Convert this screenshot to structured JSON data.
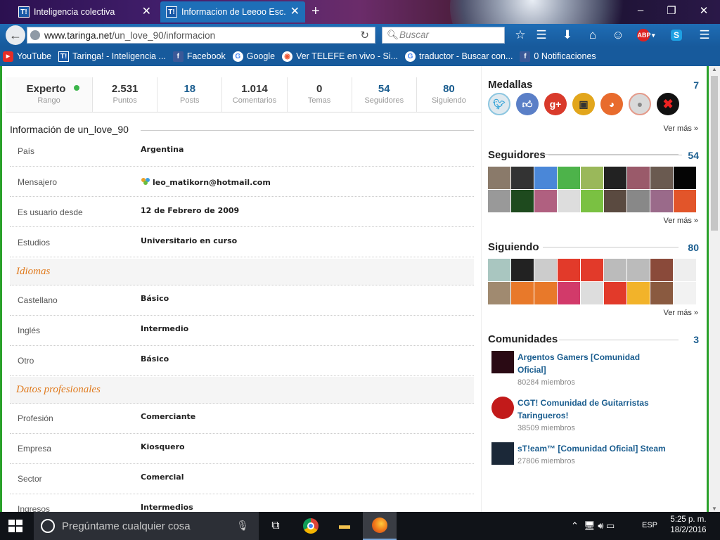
{
  "browser": {
    "tabs": [
      {
        "label": "Inteligencia colectiva",
        "favicon": "T!"
      },
      {
        "label": "Informacion de Leeoo Esc...",
        "favicon": "T!"
      }
    ],
    "url_domain": "www.taringa.net",
    "url_path": "/un_love_90/informacion",
    "search_placeholder": "Buscar",
    "abp_label": "ABP",
    "bookmarks": [
      {
        "label": "YouTube",
        "icon": "youtube-icon"
      },
      {
        "label": "Taringa! - Inteligencia ...",
        "icon": "T!"
      },
      {
        "label": "Facebook",
        "icon": "facebook-icon"
      },
      {
        "label": "Google",
        "icon": "google-icon"
      },
      {
        "label": "Ver TELEFE en vivo - Si...",
        "icon": "eye-icon"
      },
      {
        "label": "traductor - Buscar con...",
        "icon": "google-icon"
      },
      {
        "label": "0 Notificaciones",
        "icon": "facebook-icon"
      }
    ]
  },
  "profile": {
    "stats": [
      {
        "value": "Experto",
        "label": "Rango"
      },
      {
        "value": "2.531",
        "label": "Puntos"
      },
      {
        "value": "18",
        "label": "Posts"
      },
      {
        "value": "1.014",
        "label": "Comentarios"
      },
      {
        "value": "0",
        "label": "Temas"
      },
      {
        "value": "54",
        "label": "Seguidores"
      },
      {
        "value": "80",
        "label": "Siguiendo"
      }
    ],
    "info_title": "Información de un_love_90",
    "rows": [
      {
        "key": "País",
        "value": "Argentina"
      },
      {
        "key": "Mensajero",
        "value": "leo_matikorn@hotmail.com"
      },
      {
        "key": "Es usuario desde",
        "value": "12 de Febrero de 2009"
      },
      {
        "key": "Estudios",
        "value": "Universitario en curso"
      }
    ],
    "section_languages": "Idiomas",
    "languages": [
      {
        "key": "Castellano",
        "value": "Básico"
      },
      {
        "key": "Inglés",
        "value": "Intermedio"
      },
      {
        "key": "Otro",
        "value": "Básico"
      }
    ],
    "section_professional": "Datos profesionales",
    "professional": [
      {
        "key": "Profesión",
        "value": "Comerciante"
      },
      {
        "key": "Empresa",
        "value": "Kiosquero"
      },
      {
        "key": "Sector",
        "value": "Comercial"
      },
      {
        "key": "Ingresos",
        "value": "Intermedios"
      }
    ]
  },
  "sidebar": {
    "medals": {
      "title": "Medallas",
      "count": "7",
      "more": "Ver más »"
    },
    "followers": {
      "title": "Seguidores",
      "count": "54",
      "more": "Ver más »"
    },
    "following": {
      "title": "Siguiendo",
      "count": "80",
      "more": "Ver más »"
    },
    "communities": {
      "title": "Comunidades",
      "count": "3",
      "items": [
        {
          "name": "Argentos Gamers [Comunidad Oficial]",
          "members": "80284 miembros"
        },
        {
          "name": "CGT! Comunidad de Guitarristas Taringueros!",
          "members": "38509 miembros"
        },
        {
          "name": "sT!eam™ [Comunidad Oficial] Steam",
          "members": "27806 miembros"
        }
      ]
    }
  },
  "taskbar": {
    "search_placeholder": "Pregúntame cualquier cosa",
    "language": "ESP",
    "time": "5:25 p. m.",
    "date": "18/2/2016"
  }
}
